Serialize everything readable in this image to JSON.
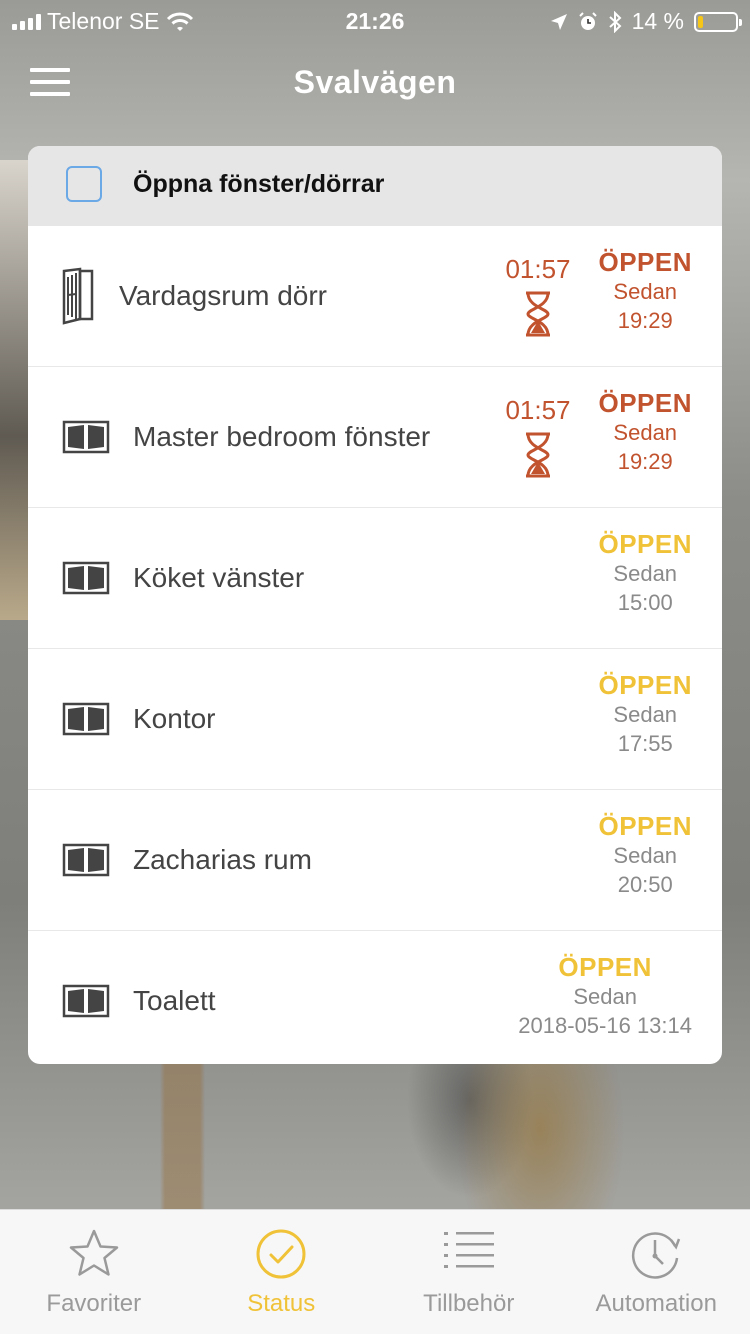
{
  "status_bar": {
    "carrier": "Telenor SE",
    "time": "21:26",
    "battery": "14 %",
    "battery_level": 0.14
  },
  "header": {
    "title": "Svalvägen"
  },
  "card": {
    "title": "Öppna fönster/dörrar",
    "rows": [
      {
        "name": "Vardagsrum dörr",
        "icon": "door-icon",
        "timer": "01:57",
        "status": "ÖPPEN",
        "since_label": "Sedan",
        "since": "19:29",
        "alert": true
      },
      {
        "name": "Master bedroom fönster",
        "icon": "window-icon",
        "timer": "01:57",
        "status": "ÖPPEN",
        "since_label": "Sedan",
        "since": "19:29",
        "alert": true
      },
      {
        "name": "Köket vänster",
        "icon": "window-icon",
        "status": "ÖPPEN",
        "since_label": "Sedan",
        "since": "15:00",
        "alert": false
      },
      {
        "name": "Kontor",
        "icon": "window-icon",
        "status": "ÖPPEN",
        "since_label": "Sedan",
        "since": "17:55",
        "alert": false
      },
      {
        "name": "Zacharias rum",
        "icon": "window-icon",
        "status": "ÖPPEN",
        "since_label": "Sedan",
        "since": "20:50",
        "alert": false
      },
      {
        "name": "Toalett",
        "icon": "window-icon",
        "status": "ÖPPEN",
        "since_label": "Sedan",
        "since": "2018-05-16 13:14",
        "alert": false
      }
    ]
  },
  "tabs": [
    {
      "label": "Favoriter",
      "icon": "star-icon",
      "active": false
    },
    {
      "label": "Status",
      "icon": "check-circle-icon",
      "active": true
    },
    {
      "label": "Tillbehör",
      "icon": "list-icon",
      "active": false
    },
    {
      "label": "Automation",
      "icon": "clock-icon",
      "active": false
    }
  ],
  "colors": {
    "accent": "#f0c238",
    "alert": "#c2532f",
    "checkbox_border": "#6aa8e6",
    "header_bg": "#e6e6e6"
  }
}
